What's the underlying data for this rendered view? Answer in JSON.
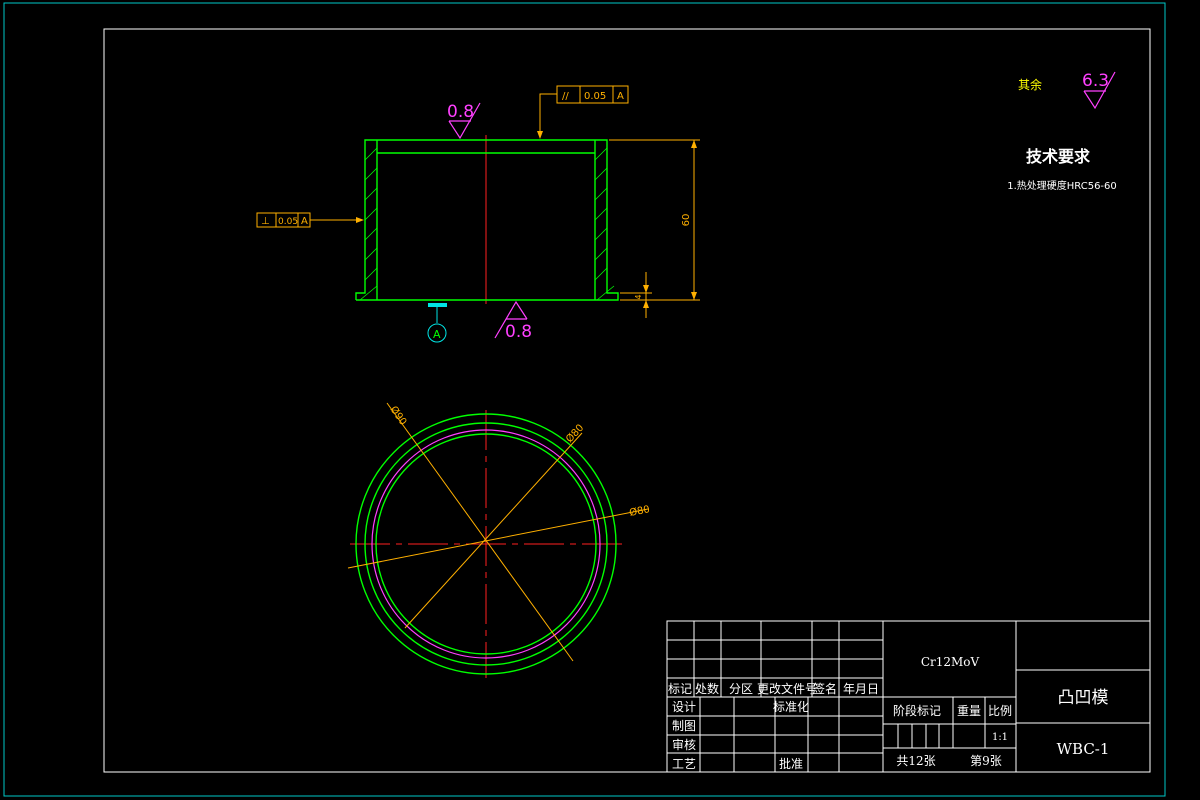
{
  "colors": {
    "background": "#000000",
    "sheet_border": "#00c8c8",
    "frame": "#ffffff",
    "outline": "#00ff00",
    "dimension": "#ffb000",
    "centerline": "#ff2020",
    "roughness": "#ff40ff",
    "datum": "#00e5e5"
  },
  "roughness": {
    "other": "其余",
    "other_value": "6.3",
    "top": "0.8",
    "bottom": "0.8"
  },
  "tech_req": {
    "title": "技术要求",
    "item1": "1.热处理硬度HRC56-60"
  },
  "tolerances": {
    "parallel_symbol": "//",
    "parallel_value": "0.05",
    "parallel_datum": "A",
    "perp_symbol": "⊥",
    "perp_value": "0.05",
    "perp_datum": "A"
  },
  "datum_label": "A",
  "dimensions": {
    "height": "60",
    "step": "4",
    "diam_outer": "Ø90",
    "diam_mid": "Ø80",
    "diam_inner": "Ø80"
  },
  "title_block": {
    "material": "Cr12MoV",
    "part_name": "凸凹模",
    "drawing_no": "WBC-1",
    "headers": [
      "标记",
      "处数",
      "分区",
      "更改文件号",
      "签名",
      "年月日"
    ],
    "row_design": "设计",
    "row_standard": "标准化",
    "row_draw": "制图",
    "row_check": "审核",
    "row_process": "工艺",
    "row_approve": "批准",
    "stage_mark": "阶段标记",
    "weight": "重量",
    "scale": "比例",
    "scale_value": "1:1",
    "total_sheets": "共12张",
    "sheet_no": "第9张"
  }
}
